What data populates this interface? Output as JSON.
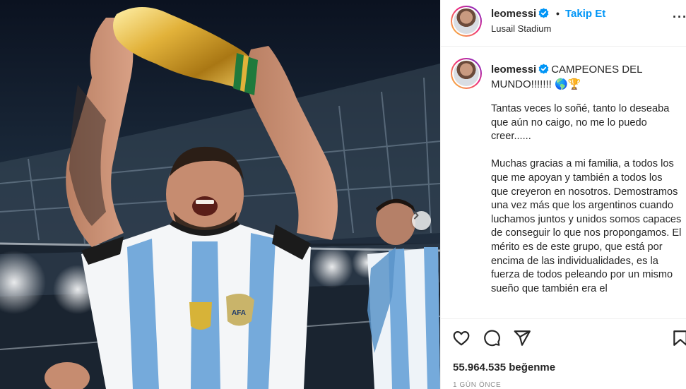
{
  "header": {
    "username": "leomessi",
    "separator": "•",
    "follow_label": "Takip Et",
    "location": "Lusail Stadium",
    "more_label": "···"
  },
  "caption": {
    "username": "leomessi",
    "title": "CAMPEONES DEL MUNDO!!!!!!! 🌎🏆",
    "body": "Tantas veces lo soñé, tanto lo deseaba que aún no caigo, no me lo puedo creer......\n\nMuchas gracias a mi familia, a todos los que me apoyan y también a todos los que creyeron en nosotros. Demostramos una vez más que los argentinos cuando luchamos juntos y unidos somos capaces de conseguir lo que nos propongamos. El mérito es de este grupo, que está por encima de las individualidades, es la fuerza de todos peleando por un mismo sueño que también era el"
  },
  "engagement": {
    "likes_text": "55.964.535 beğenme",
    "time_text": "1 GÜN ÖNCE"
  },
  "icons": {
    "like": "heart-icon",
    "comment": "comment-icon",
    "share": "send-icon",
    "save": "bookmark-icon",
    "verified": "verified-badge-icon",
    "carousel_next": "chevron-right-icon"
  },
  "colors": {
    "accent_link": "#0095f6",
    "verified_blue": "#0095f6",
    "jersey_blue": "#75aadb",
    "trophy_gold": "#d4a520"
  }
}
